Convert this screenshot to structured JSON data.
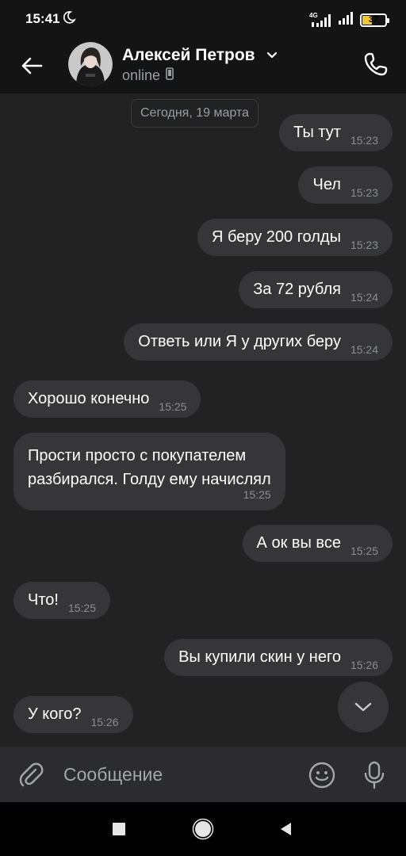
{
  "status_bar": {
    "time": "15:41",
    "network": "4G",
    "battery": "37"
  },
  "header": {
    "contact_name": "Алексей Петров",
    "contact_status": "online"
  },
  "chat": {
    "date_label": "Сегодня, 19 марта",
    "messages": [
      {
        "direction": "out",
        "text": "Ты тут",
        "time": "15:23"
      },
      {
        "direction": "out",
        "text": "Чел",
        "time": "15:23"
      },
      {
        "direction": "out",
        "text": "Я беру 200 голды",
        "time": "15:23"
      },
      {
        "direction": "out",
        "text": "За 72 рубля",
        "time": "15:24"
      },
      {
        "direction": "out",
        "text": "Ответь или Я у других беру",
        "time": "15:24"
      },
      {
        "direction": "in",
        "text": "Хорошо конечно",
        "time": "15:25"
      },
      {
        "direction": "in",
        "lines": [
          "Прости просто с покупателем",
          "разбирался. Голду ему начислял"
        ],
        "time": "15:25"
      },
      {
        "direction": "out",
        "text": "А ок вы все",
        "time": "15:25"
      },
      {
        "direction": "in",
        "text": "Что!",
        "time": "15:25"
      },
      {
        "direction": "out",
        "text": "Вы купили скин у него",
        "time": "15:26"
      },
      {
        "direction": "in",
        "text": "У кого?",
        "time": "15:26"
      }
    ]
  },
  "composer": {
    "placeholder": "Сообщение"
  },
  "icons": {
    "moon": "moon-icon",
    "back": "back-arrow-icon",
    "chevron": "chevron-down-icon",
    "phone": "phone-icon",
    "scroll_down": "chevron-down-icon",
    "attach": "paperclip-icon",
    "emoji": "smile-icon",
    "mic": "microphone-icon",
    "nav_recents": "square-icon",
    "nav_home": "circle-icon",
    "nav_back": "triangle-back-icon"
  },
  "colors": {
    "background": "#222222",
    "bar": "#141414",
    "bubble": "#363638",
    "composer": "#2c2c2e",
    "battery": "#f2c73b"
  }
}
